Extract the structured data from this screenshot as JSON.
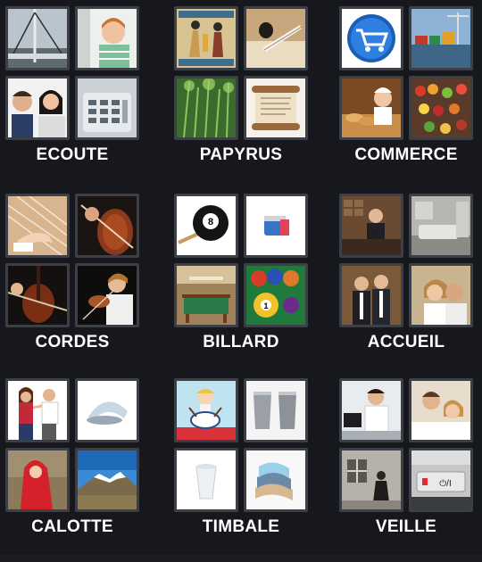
{
  "puzzles": [
    {
      "answer": "ECOUTE",
      "images": [
        "sailboat-rigging",
        "child-listening-at-wall",
        "people-on-phone",
        "telephone-keypad"
      ]
    },
    {
      "answer": "PAPYRUS",
      "images": [
        "egyptian-papyrus-painting",
        "ink-and-quill",
        "papyrus-plants",
        "rolled-scroll"
      ]
    },
    {
      "answer": "COMMERCE",
      "images": [
        "shopping-cart-icon",
        "cargo-port",
        "bakery-shop",
        "market-stall"
      ]
    },
    {
      "answer": "CORDES",
      "images": [
        "harp-strings",
        "violin-bow",
        "cello-player",
        "violin-player"
      ]
    },
    {
      "answer": "BILLARD",
      "images": [
        "eight-ball-and-cue",
        "blue-chalk",
        "billiard-room",
        "billiard-balls"
      ]
    },
    {
      "answer": "ACCUEIL",
      "images": [
        "hotel-reception-desk",
        "lobby-reception",
        "receptionists",
        "couple-smiling"
      ]
    },
    {
      "answer": "CALOTTE",
      "images": [
        "couple-arguing",
        "cap-brim",
        "red-hood-girl",
        "snowy-mountain"
      ]
    },
    {
      "answer": "TIMBALE",
      "images": [
        "child-drumming-cartoon",
        "metal-cups",
        "plastic-cup",
        "stacked-timbale-cups"
      ]
    },
    {
      "answer": "VEILLE",
      "images": [
        "doctor-at-desk",
        "couple-in-bed",
        "night-guard-by-building",
        "standby-button"
      ]
    }
  ]
}
